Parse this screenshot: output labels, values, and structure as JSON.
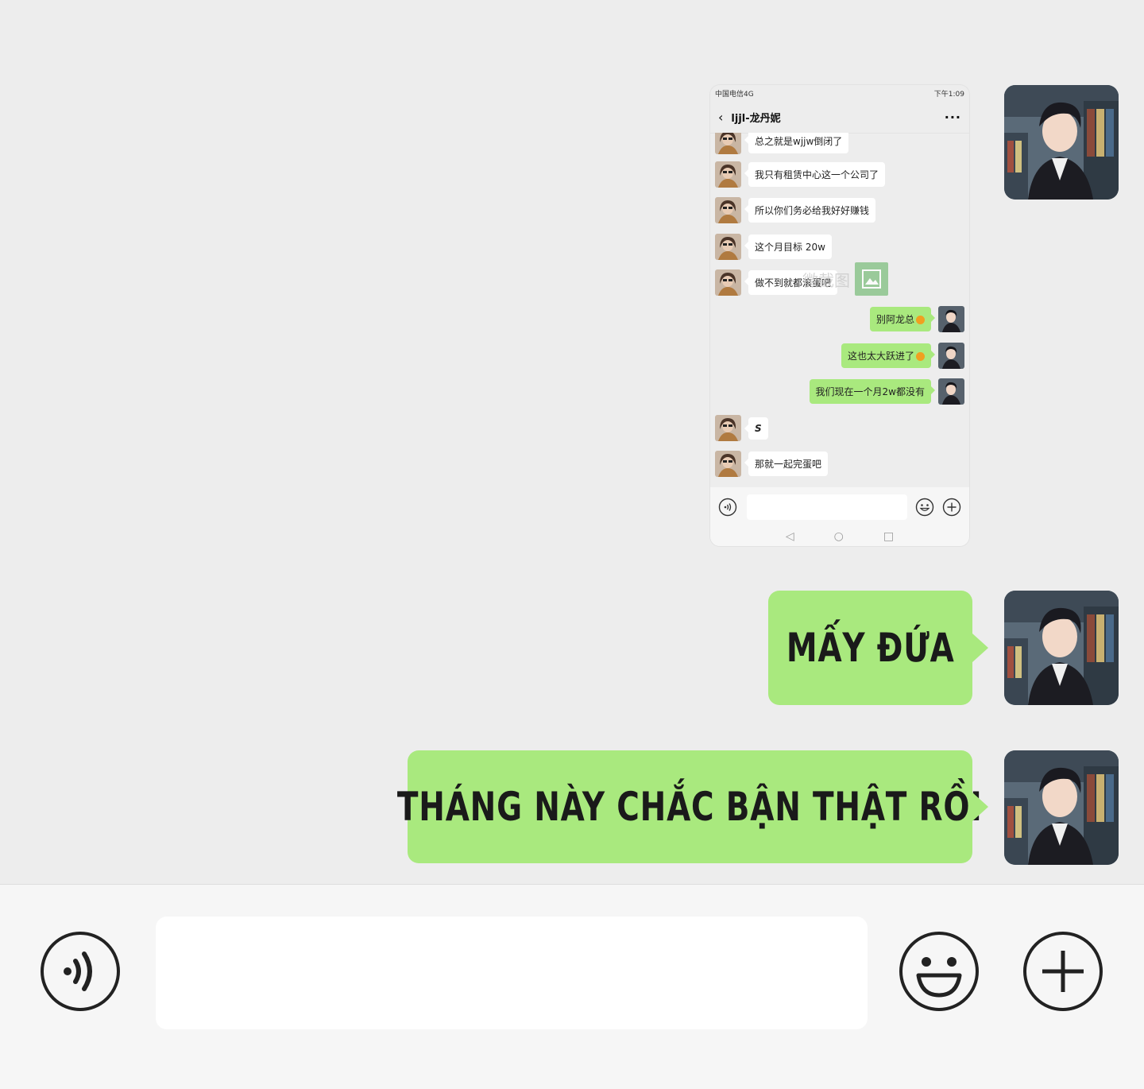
{
  "screenshot": {
    "status_left": "中国电信4G",
    "status_right": "下午1:09",
    "back_icon": "chevron-left-icon",
    "chat_title": "ljjl-龙丹妮",
    "more_label": "···",
    "messages": [
      {
        "side": "left",
        "text": "总之就是wjjw倒闭了"
      },
      {
        "side": "left",
        "text": "我只有租赁中心这一个公司了"
      },
      {
        "side": "left",
        "text": "所以你们务必给我好好赚钱"
      },
      {
        "side": "left",
        "text": "这个月目标 20w"
      },
      {
        "side": "left",
        "text": "做不到就都滚蛋吧"
      },
      {
        "side": "right",
        "text": "别阿龙总"
      },
      {
        "side": "right",
        "text": "这也太大跃进了"
      },
      {
        "side": "right",
        "text": "我们现在一个月2w都没有"
      },
      {
        "side": "left",
        "text": "S"
      },
      {
        "side": "left",
        "text": "那就一起完蛋吧"
      }
    ],
    "watermark": "微截图",
    "nav": [
      "◁",
      "○",
      "□"
    ]
  },
  "bubbles": {
    "first": "MẤY ĐỨA",
    "second": "THÁNG NÀY CHẮC BẬN THẬT RỒI"
  },
  "input_bar": {
    "voice_icon": "voice-icon",
    "emoji_icon": "emoji-icon",
    "plus_icon": "plus-icon",
    "text_value": ""
  },
  "colors": {
    "background": "#ededed",
    "bubble_green": "#a9e97e",
    "bar_bg": "#f6f6f6"
  }
}
